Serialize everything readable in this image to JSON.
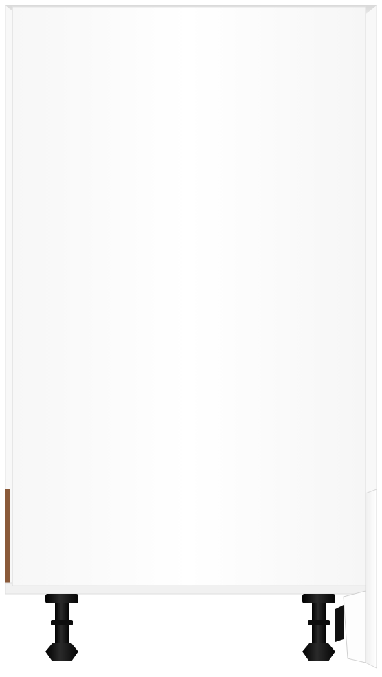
{
  "product": {
    "kind": "kitchen base cabinet",
    "view": "front",
    "door": "closed",
    "right_side_panel": "ajar",
    "feet_count": 2
  },
  "colors": {
    "background": "#ffffff",
    "carcass": "#f9f9f9",
    "door_front": "#fcfcfc",
    "top_opening_shade": "#e6e6e6",
    "edge_line": "#d8d8d8",
    "shadow": "#cfcfcf",
    "feet": "#141414",
    "back_panel_wood": "#8a5a3a"
  },
  "icons": {
    "foot_left": "adjustable-leg-icon",
    "foot_right": "adjustable-leg-icon"
  }
}
